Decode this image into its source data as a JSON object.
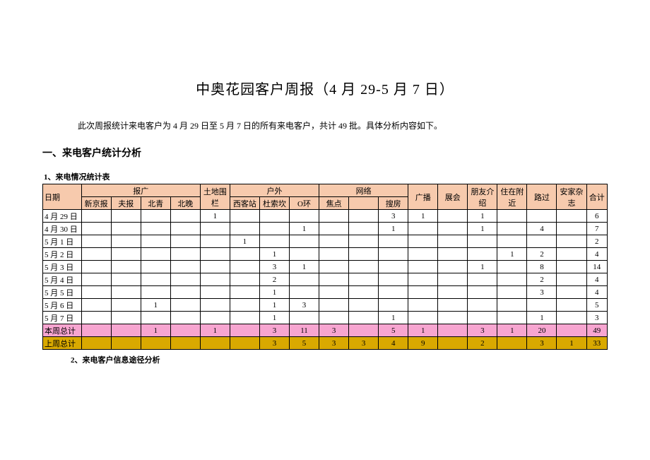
{
  "title": "中奥花园客户周报（4 月 29-5 月 7 日）",
  "intro": "此次周报统计来电客户为 4 月 29 日至 5 月 7 日的所有来电客户，共计 49 批。具体分析内容如下。",
  "section1_heading": "一、来电客户统计分析",
  "sub1_heading": "1、来电情况统计表",
  "sub2_heading": "2、来电客户信息途径分析",
  "table": {
    "header_top": {
      "date": "日期",
      "group1": "报广",
      "group2": "户外",
      "group3": "网络",
      "guangbo": "广播",
      "zhanhui": "展会",
      "pengyou": "朋友介绍",
      "zhuzai": "住在附近",
      "luguo": "路过",
      "anjia": "安家杂志",
      "heji": "合计"
    },
    "header_sub": {
      "xinjing": "新京报",
      "fabao": "夫报",
      "beiqing": "北青",
      "beiwan": "北晚",
      "tudi": "土地围栏",
      "xikezhan": "西客站",
      "dusuokan": "杜索坎",
      "ohuan": "O环",
      "jiaodian": "焦点",
      "soufang": "搜房"
    },
    "rows": [
      {
        "date": "4 月 29 日",
        "cells": [
          "",
          "",
          "",
          "",
          "1",
          "",
          "",
          "",
          "",
          "",
          "3",
          "1",
          "",
          "1",
          "",
          "",
          "",
          "6"
        ]
      },
      {
        "date": "4 月 30 日",
        "cells": [
          "",
          "",
          "",
          "",
          "",
          "",
          "",
          "1",
          "",
          "",
          "1",
          "",
          "",
          "1",
          "",
          "4",
          "",
          "7"
        ]
      },
      {
        "date": "5 月 1 日",
        "cells": [
          "",
          "",
          "",
          "",
          "",
          "1",
          "",
          "",
          "",
          "",
          "",
          "",
          "",
          "",
          "",
          "",
          "",
          "2"
        ]
      },
      {
        "date": "5 月 2 日",
        "cells": [
          "",
          "",
          "",
          "",
          "",
          "",
          "1",
          "",
          "",
          "",
          "",
          "",
          "",
          "",
          "1",
          "2",
          "",
          "4"
        ]
      },
      {
        "date": "5 月 3 日",
        "cells": [
          "",
          "",
          "",
          "",
          "",
          "",
          "3",
          "1",
          "",
          "",
          "",
          "",
          "",
          "1",
          "",
          "8",
          "",
          "14"
        ]
      },
      {
        "date": "5 月 4 日",
        "cells": [
          "",
          "",
          "",
          "",
          "",
          "",
          "2",
          "",
          "",
          "",
          "",
          "",
          "",
          "",
          "",
          "2",
          "",
          "4"
        ]
      },
      {
        "date": "5 月 5 日",
        "cells": [
          "",
          "",
          "",
          "",
          "",
          "",
          "1",
          "",
          "",
          "",
          "",
          "",
          "",
          "",
          "",
          "3",
          "",
          "4"
        ]
      },
      {
        "date": "5 月 6 日",
        "cells": [
          "",
          "",
          "1",
          "",
          "",
          "",
          "1",
          "3",
          "",
          "",
          "",
          "",
          "",
          "",
          "",
          "",
          "",
          "5"
        ]
      },
      {
        "date": "5 月 7 日",
        "cells": [
          "",
          "",
          "",
          "",
          "",
          "",
          "1",
          "",
          "",
          "",
          "1",
          "",
          "",
          "",
          "",
          "1",
          "",
          "3"
        ]
      }
    ],
    "total_this_week": {
      "label": "本周总计",
      "cells": [
        "",
        "",
        "1",
        "",
        "1",
        "",
        "3",
        "11",
        "3",
        "",
        "5",
        "1",
        "",
        "3",
        "1",
        "20",
        "",
        "49"
      ]
    },
    "total_last_week": {
      "label": "上周总计",
      "cells": [
        "",
        "",
        "",
        "",
        "",
        "",
        "3",
        "5",
        "3",
        "3",
        "4",
        "9",
        "",
        "2",
        "",
        "3",
        "1",
        "33"
      ]
    }
  }
}
